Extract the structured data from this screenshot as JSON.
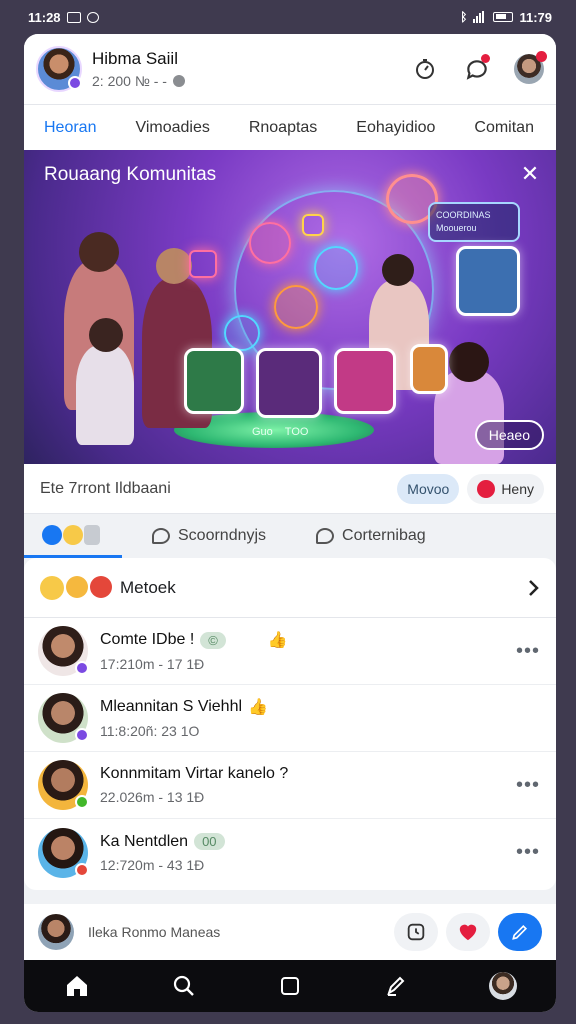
{
  "status_bar": {
    "time": "11:28",
    "right_time": "11:79"
  },
  "header": {
    "profile_name": "Hibma Saiil",
    "profile_meta": "2: 200 № - -"
  },
  "tabs": [
    {
      "label": "Heoran",
      "active": true
    },
    {
      "label": "Vimoadies",
      "active": false
    },
    {
      "label": "Rnoaptas",
      "active": false
    },
    {
      "label": "Eohayidioo",
      "active": false
    },
    {
      "label": "Comitan",
      "active": false
    }
  ],
  "banner": {
    "title": "Rouaang Komunitas",
    "close_glyph": "✕",
    "button_label": "Heaeo",
    "bubble_texts": [
      "COORDINAS",
      "Moouerou",
      "Guo",
      "TOO"
    ]
  },
  "status_row": {
    "text": "Ete 7rront Ildbaani",
    "move_chip": "Movoo",
    "heart_chip": "Heny"
  },
  "reaction_tabs": [
    {
      "label": "",
      "active": true
    },
    {
      "label": "Scoorndnyjs",
      "active": false
    },
    {
      "label": "Corternibag",
      "active": false
    }
  ],
  "list": {
    "header_title": "Metoek",
    "items": [
      {
        "title": "Comte IDbe !",
        "pill": "©",
        "extra": "👍",
        "subtitle": "17:210m - 17  1Ð"
      },
      {
        "title": "Mleannitan S  Viehhl",
        "pill": "",
        "extra": "👍",
        "subtitle": "11:8:20ñ: 23  1O"
      },
      {
        "title": "Konnmitam  Virtar kanelo ?",
        "pill": "",
        "extra": "",
        "subtitle": "22.026m - 13  1Ð"
      },
      {
        "title": "Ka Nentdlen",
        "pill": "00",
        "extra": "",
        "subtitle": "12:720m - 43  1Ð"
      }
    ]
  },
  "composer": {
    "placeholder": "Ileka Ronmo Maneas"
  },
  "colors": {
    "accent": "#1877f2",
    "banner_purple": "#7a3bc4",
    "heart_red": "#e41e3f"
  }
}
